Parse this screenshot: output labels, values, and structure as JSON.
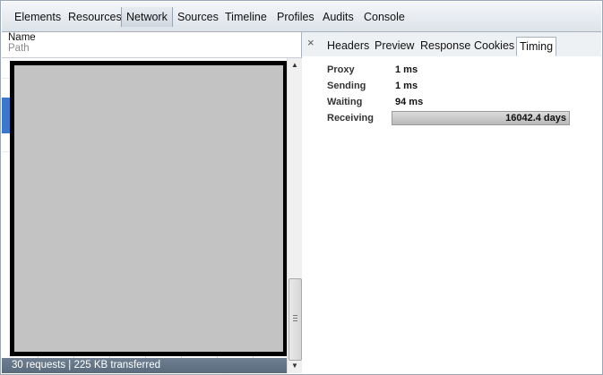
{
  "toolbar": {
    "tabs": [
      "Elements",
      "Resources",
      "Network",
      "Sources",
      "Timeline",
      "Profiles",
      "Audits",
      "Console"
    ],
    "active": "Network"
  },
  "network_list": {
    "columns": {
      "name": "Name",
      "path": "Path"
    },
    "status": "30 requests  |  225 KB transferred"
  },
  "details": {
    "close_glyph": "×",
    "tabs": [
      "Headers",
      "Preview",
      "Response",
      "Cookies",
      "Timing"
    ],
    "active": "Timing",
    "timing": [
      {
        "label": "Proxy",
        "value": "1 ms"
      },
      {
        "label": "Sending",
        "value": "1 ms"
      },
      {
        "label": "Waiting",
        "value": "94 ms"
      },
      {
        "label": "Receiving",
        "value": "16042.4 days",
        "bar_fill": 1.0
      }
    ]
  },
  "scrollbar": {
    "up": "▲",
    "down": "▼"
  },
  "colors": {
    "selection": "#3b78cb",
    "status_bar": "#5f7084",
    "preview_fill": "#c3c3c3"
  }
}
